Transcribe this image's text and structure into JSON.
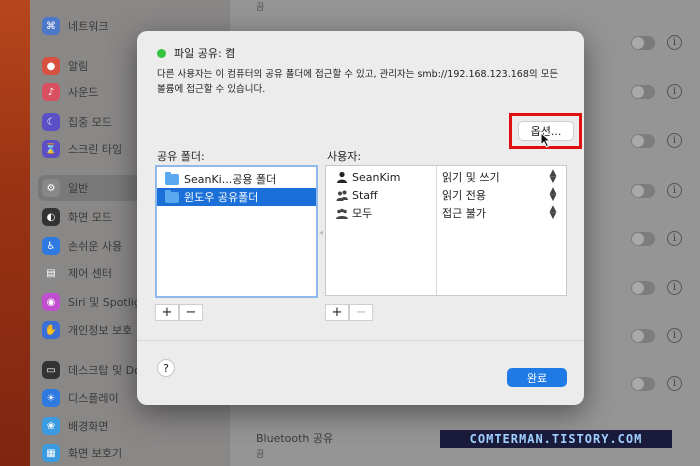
{
  "sidebar": {
    "items": [
      {
        "label": "네트워크",
        "icon": "network-icon",
        "color": "#4b78c9"
      },
      {
        "label": "알림",
        "icon": "bell-icon",
        "color": "#d85040"
      },
      {
        "label": "사운드",
        "icon": "speaker-icon",
        "color": "#d85060"
      },
      {
        "label": "집중 모드",
        "icon": "moon-icon",
        "color": "#5a4fc4"
      },
      {
        "label": "스크린 타임",
        "icon": "hourglass-icon",
        "color": "#5a4fc4"
      },
      {
        "label": "일반",
        "icon": "gear-icon",
        "color": "#888888"
      },
      {
        "label": "화면 모드",
        "icon": "appearance-icon",
        "color": "#333333"
      },
      {
        "label": "손쉬운 사용",
        "icon": "accessibility-icon",
        "color": "#2f7ae0"
      },
      {
        "label": "제어 센터",
        "icon": "control-center-icon",
        "color": "#888888"
      },
      {
        "label": "Siri 및 Spotlight",
        "icon": "siri-icon",
        "color": "#c04fd0"
      },
      {
        "label": "개인정보 보호",
        "icon": "hand-icon",
        "color": "#3a6ed8"
      },
      {
        "label": "데스크탑 및 Dock",
        "icon": "desktop-icon",
        "color": "#333333"
      },
      {
        "label": "디스플레이",
        "icon": "display-icon",
        "color": "#2f7ae0"
      },
      {
        "label": "배경화면",
        "icon": "wallpaper-icon",
        "color": "#3a9be0"
      },
      {
        "label": "화면 보호기",
        "icon": "screensaver-icon",
        "color": "#3a9be0"
      }
    ]
  },
  "main": {
    "top_sub": "끔",
    "bluetooth_label": "Bluetooth 공유",
    "bluetooth_sub": "끔",
    "info_glyph": "i"
  },
  "dialog": {
    "title": "파일 공유: 켬",
    "status_color": "#34c23f",
    "description": "다른 사용자는 이 컴퓨터의 공유 폴더에 접근할 수 있고, 관리자는 smb://192.168.123.168의 모든 볼륨에 접근할 수 있습니다.",
    "options_label": "옵션...",
    "shared_folders_label": "공유 폴더:",
    "users_label": "사용자:",
    "folders": [
      {
        "name": "SeanKi...공용 폴더",
        "selected": false
      },
      {
        "name": "윈도우 공유폴더",
        "selected": true
      }
    ],
    "users": [
      {
        "name": "SeanKim",
        "permission": "읽기 및 쓰기",
        "icon": "person-icon"
      },
      {
        "name": "Staff",
        "permission": "읽기 전용",
        "icon": "group-icon"
      },
      {
        "name": "모두",
        "permission": "접근 불가",
        "icon": "everyone-icon"
      }
    ],
    "add_glyph": "+",
    "remove_glyph": "−",
    "help_glyph": "?",
    "done_label": "완료"
  },
  "watermark": "COMTERMAN.TISTORY.COM"
}
